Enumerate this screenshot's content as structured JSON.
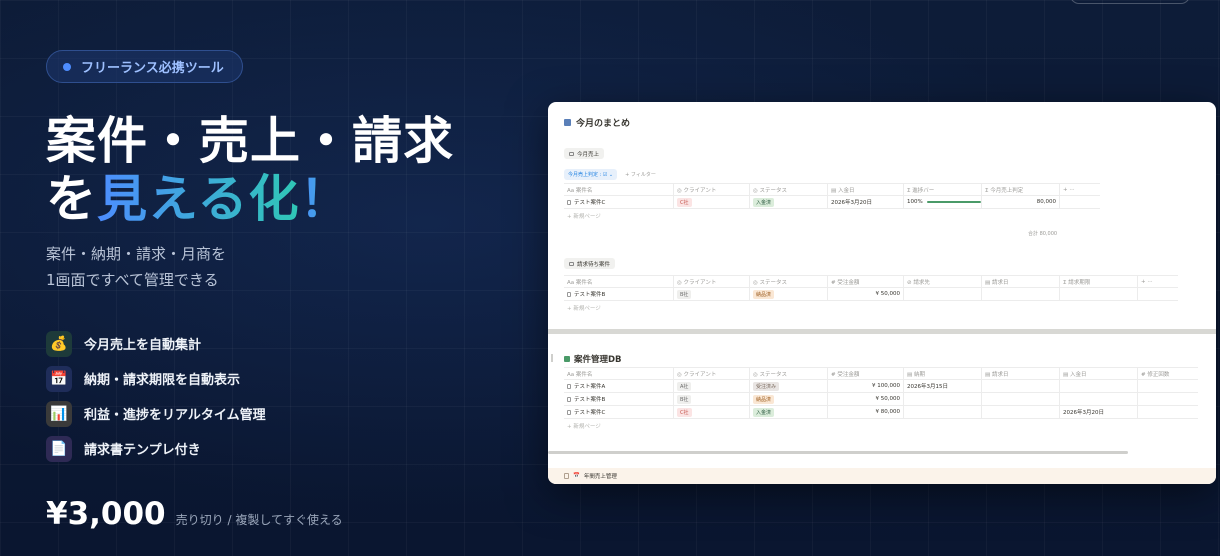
{
  "hero": {
    "badge": "フリーランス必携ツール",
    "headline_line1": "案件・売上・請求",
    "headline_line2_prefix": "を",
    "headline_line2_accent": "見える化",
    "headline_line2_suffix": "！",
    "sub_line1": "案件・納期・請求・月商を",
    "sub_line2": "1画面ですべて管理できる"
  },
  "features": [
    {
      "icon": "money-bag-icon",
      "glyph": "💰",
      "label": "今月売上を自動集計",
      "bg": "#1d3a3a"
    },
    {
      "icon": "calendar-icon",
      "glyph": "📅",
      "label": "納期・請求期限を自動表示",
      "bg": "#1f2d5a"
    },
    {
      "icon": "bar-chart-icon",
      "glyph": "📊",
      "label": "利益・進捗をリアルタイム管理",
      "bg": "#3a3a3a"
    },
    {
      "icon": "receipt-icon",
      "glyph": "📄",
      "label": "請求書テンプレ付き",
      "bg": "#2e2a55"
    }
  ],
  "price": {
    "value": "¥3,000",
    "note": "売り切り / 複製してすぐ使える"
  },
  "screenshot": {
    "title": "今月のまとめ",
    "view1": "今月売上",
    "filter_chip": "今月売上判定 : ☑ ⌄",
    "filter_add": "+ フィルター",
    "table1": {
      "headers": [
        "Aa 案件名",
        "◎ クライアント",
        "◎ ステータス",
        "▤ 入金日",
        "Σ 進捗バー",
        "Σ 今月売上判定",
        "+ ···"
      ],
      "row": {
        "name": "テスト案件C",
        "client": "C社",
        "status": "入金済",
        "date": "2026年3月20日",
        "progress": "100%",
        "amount": "80,000"
      },
      "new_page": "+ 新規ページ",
      "sum": "合計 80,000"
    },
    "view2": "請求待ち案件",
    "table2": {
      "headers": [
        "Aa 案件名",
        "◎ クライアント",
        "◎ ステータス",
        "# 受注金額",
        "⊘ 請求先",
        "▤ 請求日",
        "Σ 請求期限",
        "+ ···"
      ],
      "row": {
        "name": "テスト案件B",
        "client": "B社",
        "status": "納品済",
        "amount": "¥ 50,000"
      },
      "new_page": "+ 新規ページ"
    },
    "db_title": "案件管理DB",
    "table3": {
      "headers": [
        "Aa 案件名",
        "◎ クライアント",
        "◎ ステータス",
        "# 受注金額",
        "▤ 納期",
        "▤ 請求日",
        "▤ 入金日",
        "# 修正回数"
      ],
      "rows": [
        {
          "name": "テスト案件A",
          "client": "A社",
          "status": "受注済み",
          "amount": "¥ 100,000",
          "deadline": "2026年3月15日",
          "paid": ""
        },
        {
          "name": "テスト案件B",
          "client": "B社",
          "status": "納品済",
          "amount": "¥ 50,000",
          "deadline": "",
          "paid": ""
        },
        {
          "name": "テスト案件C",
          "client": "C社",
          "status": "入金済",
          "amount": "¥ 80,000",
          "deadline": "",
          "paid": "2026年3月20日"
        }
      ],
      "new_page": "+ 新規ページ"
    },
    "footer_section": "年間売上管理"
  }
}
